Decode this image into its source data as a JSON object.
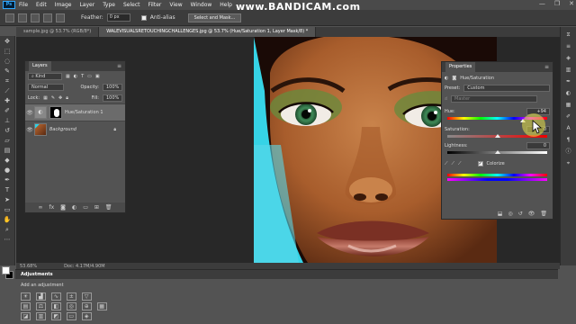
{
  "app": {
    "logo_text": "Ps"
  },
  "menu": [
    "File",
    "Edit",
    "Image",
    "Layer",
    "Type",
    "Select",
    "Filter",
    "View",
    "Window",
    "Help"
  ],
  "watermark": "www.BANDICAM.com",
  "window_controls": [
    "—",
    "❐",
    "✕"
  ],
  "options": {
    "feather_label": "Feather:",
    "feather_value": "0 px",
    "antialias_label": "Anti-alias",
    "select_mask_label": "Select and Mask..."
  },
  "tabs": [
    {
      "label": "sample.jpg @ 53.7% (RGB/8*)",
      "active": false
    },
    {
      "label": "WALEVISUALSRETOUCHINGCHALLENGES.jpg @ 53.7% (Hue/Saturation 1, Layer Mask/8) *",
      "active": true
    }
  ],
  "layers_panel": {
    "tab_label": "Layers",
    "kind_label": "Kind",
    "blend_mode": "Normal",
    "opacity_label": "Opacity:",
    "opacity_value": "100%",
    "lock_label": "Lock:",
    "fill_label": "Fill:",
    "fill_value": "100%",
    "layers": [
      {
        "name": "Hue/Saturation 1",
        "active": true
      },
      {
        "name": "Background",
        "active": false
      }
    ],
    "footer_icons": [
      "link-icon",
      "fx-icon",
      "mask-icon",
      "adjustment-icon",
      "group-icon",
      "new-layer-icon",
      "trash-icon"
    ]
  },
  "properties_panel": {
    "tab_label": "Properties",
    "title": "Hue/Saturation",
    "preset_label": "Preset:",
    "preset_value": "Custom",
    "channel_value": "Master",
    "hue_label": "Hue:",
    "hue_value": "+94",
    "saturation_label": "Saturation:",
    "saturation_value": "0",
    "lightness_label": "Lightness:",
    "lightness_value": "0",
    "colorize_label": "Colorize",
    "colorize_checked": true,
    "hue_fraction": 0.76,
    "saturation_fraction": 0.5,
    "lightness_fraction": 0.5
  },
  "status": {
    "zoom": "53.68%",
    "doc": "Doc: 4.17M/4.90M"
  },
  "adjustments_panel": {
    "tab_label": "Adjustments",
    "add_label": "Add an adjustment"
  },
  "colors": {
    "accent": "#31a8ff",
    "panel_bg": "#535353",
    "dark_bg": "#3c3c3c"
  }
}
